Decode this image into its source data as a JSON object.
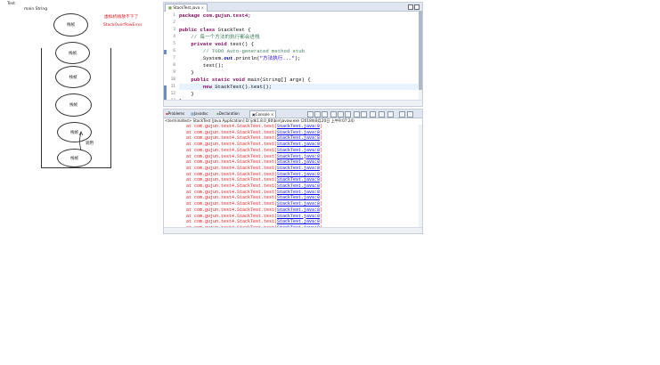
{
  "diagram": {
    "top_label": "Test",
    "sub_label": "main String",
    "frame_label": "栈帧",
    "error_line1": "虚拟机栈放不下了",
    "error_line2": "StackOverflowError",
    "call_label": "调用"
  },
  "editor": {
    "tab_label": "StackTest.java",
    "line_numbers": [
      "1",
      "2",
      "3",
      "4",
      "5",
      "6",
      "7",
      "8",
      "9",
      "10",
      "11",
      "12",
      "13"
    ],
    "lines": {
      "l1": "package com.gujun.test4;",
      "l3a": "public class ",
      "l3b": "StackTest {",
      "l4": "    // 每一个方法的执行都会进栈",
      "l5a": "    private void ",
      "l5b": "test() {",
      "l6": "        // TODO Auto-generated method stub",
      "l7a": "        System.",
      "l7b": "out",
      "l7c": ".println(",
      "l7d": "\"方法执行...\"",
      "l7e": ");",
      "l8": "        test();",
      "l9": "    }",
      "l10a": "    public static void ",
      "l10b": "main(String[] args) {",
      "l11a": "        new ",
      "l11b": "StackTest().test();",
      "l12": "    }",
      "l13": "}"
    }
  },
  "console": {
    "tabs": [
      "Problems",
      "Javadoc",
      "Declaration",
      "Console"
    ],
    "terminated": "<terminated> StackTest [Java Application] D:\\jdk1.8.0_80\\bin\\javaw.exe (2018年8月20日 上午9:07:24)",
    "trace_prefix": "at com.gujun.test4.StackTest.test(",
    "trace_link": "StackTest.java:8",
    "trace_suffix": ")"
  }
}
